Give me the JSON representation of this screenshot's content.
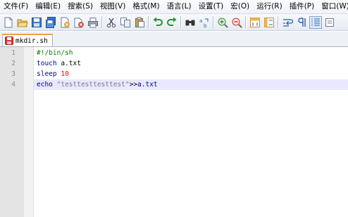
{
  "menu": [
    "文件(F)",
    "编辑(E)",
    "搜索(S)",
    "视图(V)",
    "格式(M)",
    "语言(L)",
    "设置(T)",
    "宏(O)",
    "运行(R)",
    "插件(P)",
    "窗口(W)"
  ],
  "toolbar": {
    "buttons": [
      {
        "icon": "new-file-icon"
      },
      {
        "icon": "open-file-icon"
      },
      {
        "icon": "save-icon"
      },
      {
        "icon": "save-all-icon"
      },
      {
        "icon": "close-icon"
      },
      {
        "icon": "close-all-icon"
      },
      {
        "icon": "print-icon"
      },
      {
        "icon": "cut-icon"
      },
      {
        "icon": "copy-icon"
      },
      {
        "icon": "paste-icon"
      },
      {
        "icon": "undo-icon"
      },
      {
        "icon": "redo-icon"
      },
      {
        "icon": "find-icon"
      },
      {
        "icon": "replace-icon"
      },
      {
        "icon": "zoom-in-icon"
      },
      {
        "icon": "zoom-out-icon"
      },
      {
        "icon": "sync-vertical-icon"
      },
      {
        "icon": "sync-horizontal-icon"
      },
      {
        "icon": "word-wrap-icon"
      },
      {
        "icon": "show-all-chars-icon"
      },
      {
        "icon": "indent-guide-icon"
      },
      {
        "icon": "more-icon"
      }
    ],
    "active_button": "indent-guide-icon"
  },
  "tab": {
    "filename": "mkdir.sh",
    "icon": "modified-file-icon",
    "accent_color": "#f0a33a"
  },
  "editor": {
    "line_numbers": [
      "1",
      "2",
      "3",
      "4"
    ],
    "current_line": 4,
    "lines": [
      {
        "comment": "#!/bin/sh"
      },
      {
        "cmd": "touch",
        "rest": " a.txt"
      },
      {
        "cmd": "sleep",
        "space": " ",
        "num": "10"
      },
      {
        "cmd": "echo",
        "space": " ",
        "str": "\"testtesttesttest\"",
        "op": ">>",
        "word": "a.txt"
      }
    ],
    "colors": {
      "comment": "#007f00",
      "keyword": "#000080",
      "number": "#ff0000",
      "string": "#7f7f7f",
      "current_line_bg": "#e8e8ff"
    }
  }
}
